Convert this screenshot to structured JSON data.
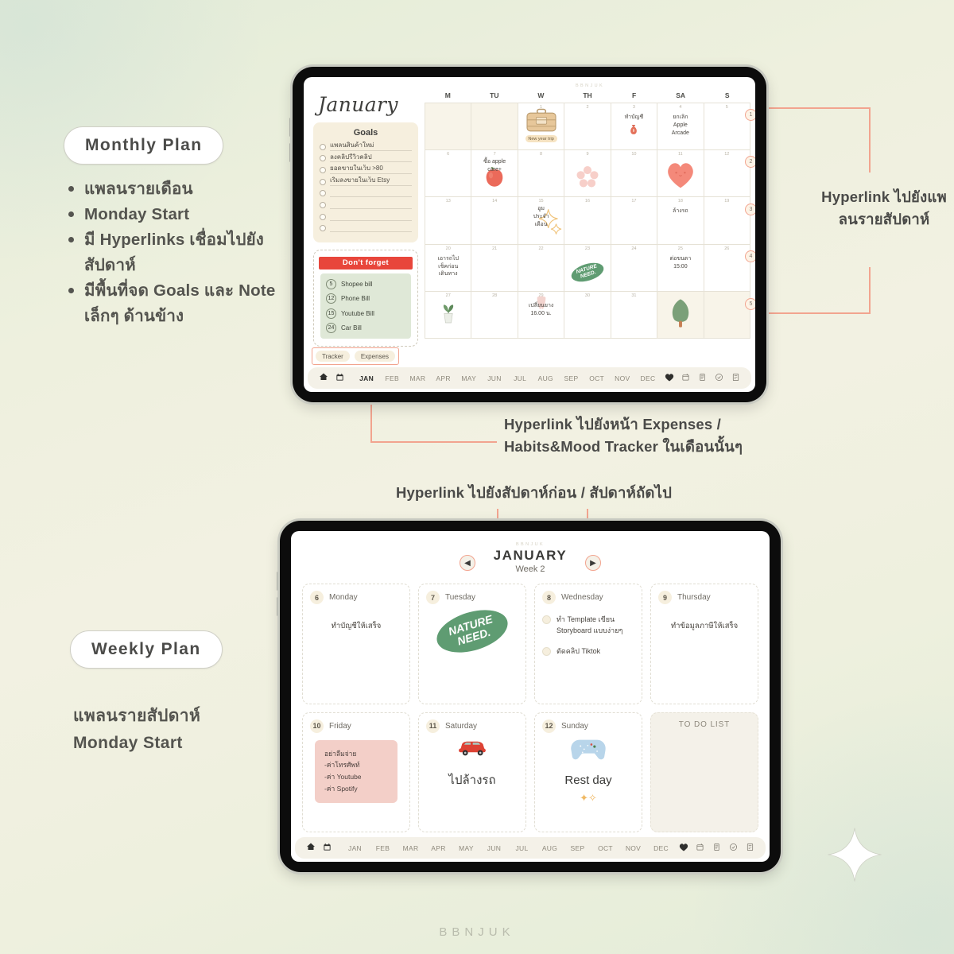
{
  "page": {
    "watermark": "BBNJUK",
    "brand_mark": "BBNJUK"
  },
  "left_panel": {
    "monthly": {
      "pill": "Monthly Plan",
      "bullets": [
        "แพลนรายเดือน",
        "Monday Start",
        "มี Hyperlinks เชื่อมไปยังสัปดาห์",
        "มีพื้นที่จด Goals และ Note เล็กๆ ด้านข้าง"
      ]
    },
    "weekly": {
      "pill": "Weekly Plan",
      "subtitle_line1": "แพลนรายสัปดาห์",
      "subtitle_line2": "Monday Start"
    }
  },
  "annotations": {
    "right_weeklink": "Hyperlink ไปยังแพลนรายสัปดาห์",
    "bottom_tabs_line1": "Hyperlink ไปยังหน้า Expenses /",
    "bottom_tabs_line2": "Habits&Mood Tracker ในเดือนนั้นๆ",
    "week_nav": "Hyperlink ไปยังสัปดาห์ก่อน / สัปดาห์ถัดไป"
  },
  "monthly_plan": {
    "title": "January",
    "goals": {
      "heading": "Goals",
      "items": [
        "แพลนสินค้าใหม่",
        "ลงคลิปรีวิวคลิป",
        "ยอดขายในเว็บ >80",
        "เริ่มลงขายในเว็บ Etsy",
        "",
        "",
        "",
        ""
      ]
    },
    "dont_forget": {
      "heading": "Don't forget",
      "items": [
        {
          "day": "5",
          "label": "Shopee bill"
        },
        {
          "day": "12",
          "label": "Phone Bill"
        },
        {
          "day": "15",
          "label": "Youtube Bill"
        },
        {
          "day": "24",
          "label": "Car Bill"
        }
      ]
    },
    "link_tabs": [
      "Tracker",
      "Expenses"
    ],
    "dow": [
      "M",
      "TU",
      "W",
      "TH",
      "F",
      "SA",
      "S"
    ],
    "week_links": [
      "1",
      "2",
      "3",
      "4",
      "5"
    ],
    "cells": [
      {
        "day": "",
        "off": true,
        "text": ""
      },
      {
        "day": "",
        "off": true,
        "text": ""
      },
      {
        "day": "1",
        "off": false,
        "text": "",
        "sticker": "suitcase",
        "sticker_label": "New year trip"
      },
      {
        "day": "2",
        "off": false,
        "text": ""
      },
      {
        "day": "3",
        "off": false,
        "text": "ทำบัญชี",
        "sticker": "moneybag"
      },
      {
        "day": "4",
        "off": false,
        "text": "ยกเลิก\nApple\nArcade"
      },
      {
        "day": "5",
        "off": false,
        "text": ""
      },
      {
        "day": "6",
        "off": false,
        "text": ""
      },
      {
        "day": "7",
        "off": false,
        "text": "ซื้อ apple\ncare+",
        "sticker": "apple"
      },
      {
        "day": "8",
        "off": false,
        "text": ""
      },
      {
        "day": "9",
        "off": false,
        "text": "",
        "sticker": "flower"
      },
      {
        "day": "10",
        "off": false,
        "text": ""
      },
      {
        "day": "11",
        "off": false,
        "text": "",
        "sticker": "heart"
      },
      {
        "day": "12",
        "off": false,
        "text": ""
      },
      {
        "day": "13",
        "off": false,
        "text": ""
      },
      {
        "day": "14",
        "off": false,
        "text": ""
      },
      {
        "day": "15",
        "off": false,
        "text": "อูม\nประจำ\nเดือน",
        "sticker": "sparkle"
      },
      {
        "day": "16",
        "off": false,
        "text": ""
      },
      {
        "day": "17",
        "off": false,
        "text": ""
      },
      {
        "day": "18",
        "off": false,
        "text": "ล้างรถ"
      },
      {
        "day": "19",
        "off": false,
        "text": ""
      },
      {
        "day": "20",
        "off": false,
        "text": "เอารถไป\nเช็คก่อน\nเดินทาง"
      },
      {
        "day": "21",
        "off": false,
        "text": ""
      },
      {
        "day": "22",
        "off": false,
        "text": ""
      },
      {
        "day": "23",
        "off": false,
        "text": "",
        "sticker": "natureneed"
      },
      {
        "day": "24",
        "off": false,
        "text": ""
      },
      {
        "day": "25",
        "off": false,
        "text": "ต่อขนตา\n15:00"
      },
      {
        "day": "26",
        "off": false,
        "text": ""
      },
      {
        "day": "27",
        "off": false,
        "text": "",
        "sticker": "plant"
      },
      {
        "day": "28",
        "off": false,
        "text": ""
      },
      {
        "day": "29",
        "off": false,
        "text": "เปลี่ยนยาง\n16.00 น.",
        "sticker": "tooth"
      },
      {
        "day": "30",
        "off": false,
        "text": ""
      },
      {
        "day": "31",
        "off": false,
        "text": ""
      },
      {
        "day": "",
        "off": true,
        "text": "",
        "sticker": "tree"
      },
      {
        "day": "",
        "off": true,
        "text": ""
      }
    ],
    "toolbar": {
      "icons_left": [
        "home-icon",
        "calendar-icon"
      ],
      "months": [
        "JAN",
        "FEB",
        "MAR",
        "APR",
        "MAY",
        "JUN",
        "JUL",
        "AUG",
        "SEP",
        "OCT",
        "NOV",
        "DEC"
      ],
      "active_month": "JAN",
      "icons_right": [
        "heart-icon",
        "tracker-icon",
        "expenses-icon",
        "check-icon",
        "note-icon"
      ]
    }
  },
  "weekly_plan": {
    "brand_mark": "BBNJUK",
    "month": "JANUARY",
    "week_label": "Week 2",
    "nav_prev": "◀",
    "nav_next": "▶",
    "days": [
      {
        "num": "6",
        "name": "Monday",
        "body": "ทำบัญชีให้เสร็จ"
      },
      {
        "num": "7",
        "name": "Tuesday",
        "body": "",
        "sticker": "natureneed"
      },
      {
        "num": "8",
        "name": "Wednesday",
        "tasks": [
          "ทำ Template เขียน Storyboard แบบง่ายๆ",
          "ตัดคลิป Tiktok"
        ]
      },
      {
        "num": "9",
        "name": "Thursday",
        "body": "ทำข้อมูลภาษีให้เสร็จ"
      },
      {
        "num": "10",
        "name": "Friday",
        "note_lines": [
          "อย่าลืมจ่าย",
          "-ค่าโทรศัพท์",
          "-ค่า Youtube",
          "-ค่า Spotify"
        ]
      },
      {
        "num": "11",
        "name": "Saturday",
        "body": "ไปล้างรถ",
        "sticker": "car"
      },
      {
        "num": "12",
        "name": "Sunday",
        "body": "Rest day",
        "sticker": "gamepad"
      }
    ],
    "todo_title": "TO DO LIST",
    "toolbar": {
      "icons_left": [
        "home-icon",
        "calendar-icon"
      ],
      "months": [
        "JAN",
        "FEB",
        "MAR",
        "APR",
        "MAY",
        "JUN",
        "JUL",
        "AUG",
        "SEP",
        "OCT",
        "NOV",
        "DEC"
      ],
      "active_month": "",
      "icons_right": [
        "heart-icon",
        "tracker-icon",
        "expenses-icon",
        "check-icon",
        "note-icon"
      ]
    }
  },
  "colors": {
    "accent_salmon": "#f2a48f",
    "bg_green": "#e3ecd8",
    "bg_cream": "#f2f1e2",
    "goals_cream": "#f6efde",
    "dont_red": "#e8463b",
    "dont_green": "#dfe8d7",
    "pink_note": "#f3cfc8",
    "nature_green": "#5f9c72"
  },
  "sticker_text": {
    "nature_need_line1": "NATURE",
    "nature_need_line2": "NEED."
  }
}
